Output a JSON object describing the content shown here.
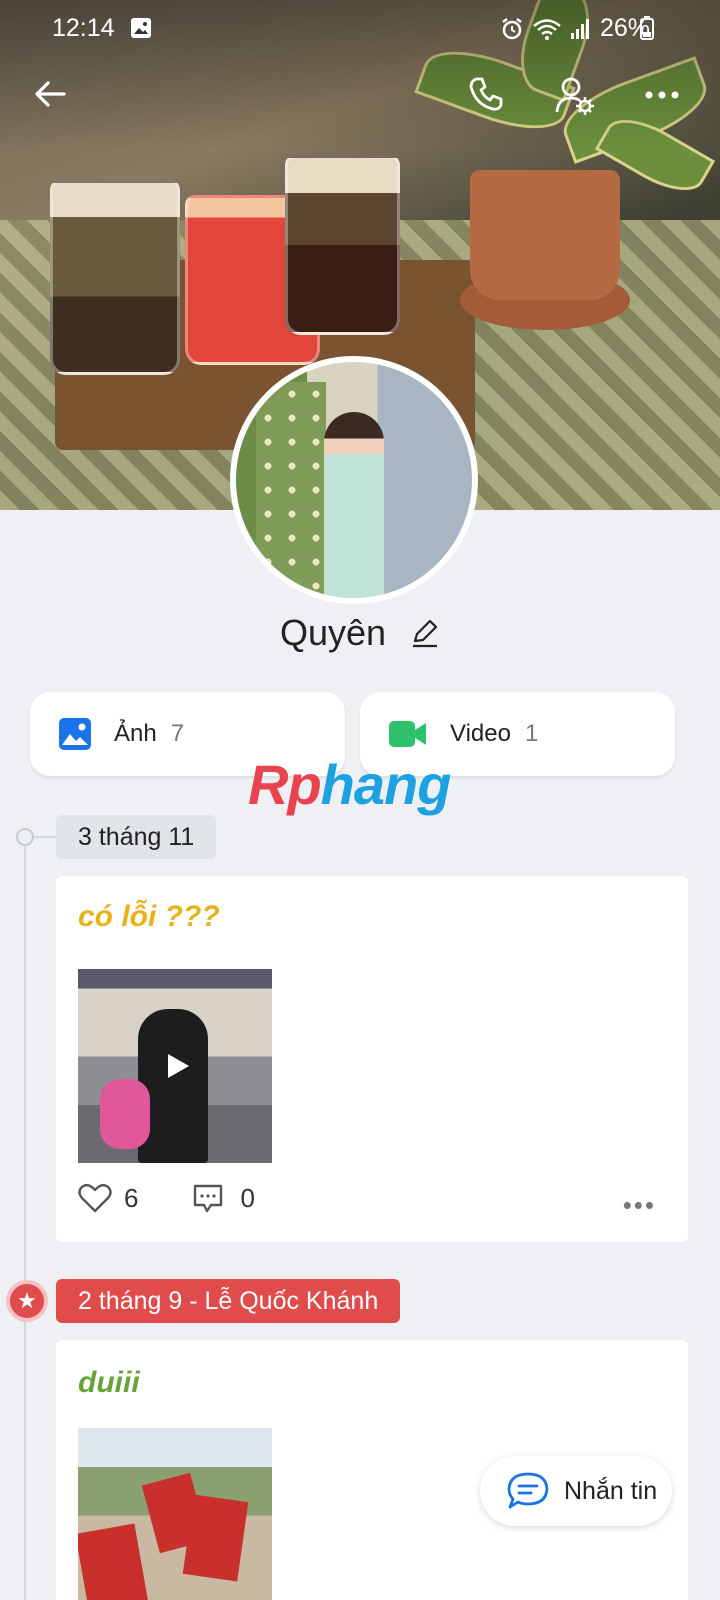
{
  "status_bar": {
    "time": "12:14",
    "battery": "26%"
  },
  "profile": {
    "name": "Quyên"
  },
  "media_buttons": [
    {
      "label": "Ảnh",
      "count": "7",
      "icon": "photo-icon",
      "color": "#1a73e8"
    },
    {
      "label": "Video",
      "count": "1",
      "icon": "video-camera-icon",
      "color": "#2ec26b"
    }
  ],
  "watermark": {
    "part1": "Rp",
    "part2": "hang"
  },
  "timeline": [
    {
      "date": "3 tháng 11",
      "title": "có lỗi ???",
      "title_color": "#e8b21b",
      "likes": "6",
      "comments": "0"
    },
    {
      "date": "2 tháng 9 - Lễ Quốc Khánh",
      "date_color": "#e04b4b",
      "title": "duiii",
      "title_color": "#6aa23a"
    }
  ],
  "message_button": {
    "label": "Nhắn tin"
  },
  "more_dots": "•••"
}
